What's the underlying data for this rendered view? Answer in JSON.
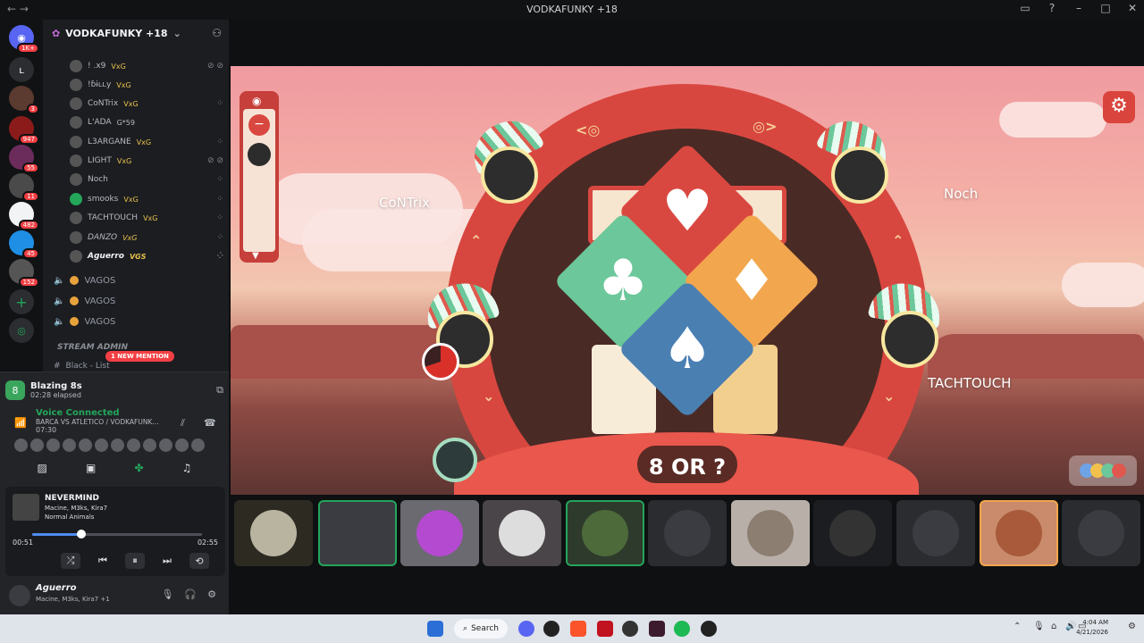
{
  "window": {
    "title": "VODKAFUNKY +18"
  },
  "guilds": [
    {
      "badge": "1K+"
    },
    {
      "badge": ""
    },
    {
      "badge": "3"
    },
    {
      "badge": "947"
    },
    {
      "badge": "55"
    },
    {
      "badge": "11"
    },
    {
      "badge": "482"
    },
    {
      "badge": "45"
    },
    {
      "badge": "152"
    }
  ],
  "server": {
    "name": "VODKAFUNKY +18"
  },
  "members": [
    {
      "name": "! .x9",
      "tag": "VxG"
    },
    {
      "name": "!ɓɨʟʟy",
      "tag": "VxG"
    },
    {
      "name": "CoNTrix",
      "tag": "VxG"
    },
    {
      "name": "L'ADA",
      "tag": "G*59"
    },
    {
      "name": "L3ARGANE",
      "tag": "VxG"
    },
    {
      "name": "LIGHT",
      "tag": "VxG"
    },
    {
      "name": "Noch",
      "tag": ""
    },
    {
      "name": "smooks",
      "tag": "VxG"
    },
    {
      "name": "TACHTOUCH",
      "tag": "VxG"
    },
    {
      "name": "DANZO",
      "tag": "VxG"
    },
    {
      "name": "Aguerro",
      "tag": "VGS"
    }
  ],
  "voice_channels": [
    "VAGOS",
    "VAGOS",
    "VAGOS"
  ],
  "category": {
    "name": "STREAM ADMIN"
  },
  "mention": "1 NEW MENTION",
  "partial_channel": "Black - List",
  "activity": {
    "name": "Blazing 8s",
    "elapsed": "02:28 elapsed"
  },
  "voice": {
    "status": "Voice Connected",
    "channel": "BARCA VS ATLETICO / VODKAFUNK...",
    "time": "07:30"
  },
  "music": {
    "song": "NEVERMIND",
    "artists": "Macine, M3ks, Kira7",
    "album": "Normal Animals",
    "elapsed": "00:51",
    "duration": "02:55",
    "progress": 0.29
  },
  "user": {
    "name": "Aguerro",
    "status": "Macine, M3ks, Kira7 +1"
  },
  "game": {
    "players": {
      "left_top": "CoNTrix",
      "right_top": "Noch",
      "right": "TACHTOUCH"
    },
    "prompt": "8 OR ?"
  },
  "colors": {
    "accent": "#d9453d",
    "voice_green": "#23a55a",
    "mention": "#f23f43"
  },
  "taskbar": {
    "search": "Search",
    "time": "4:04 AM",
    "date": "4/21/2026"
  }
}
